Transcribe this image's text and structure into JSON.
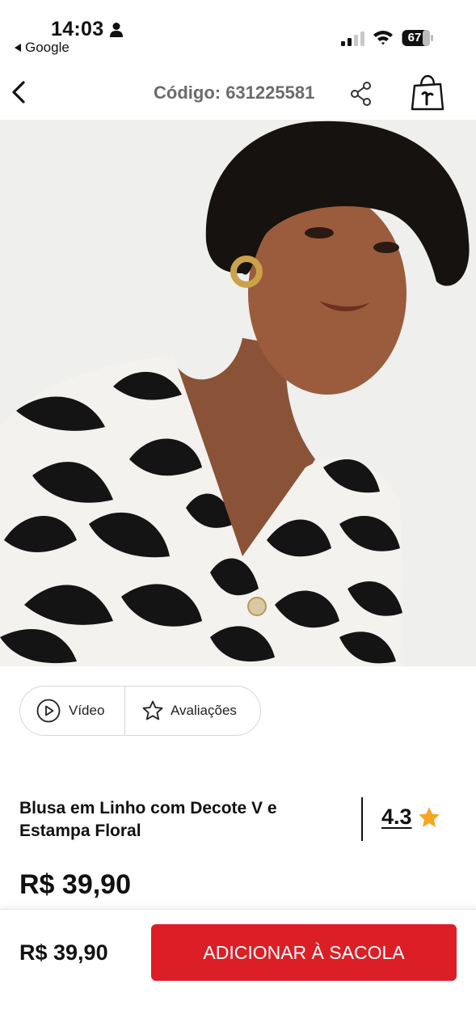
{
  "status_bar": {
    "time": "14:03",
    "back_app": "Google",
    "battery": "67",
    "icons": [
      "person-icon",
      "signal-icon",
      "wifi-icon",
      "battery-icon"
    ]
  },
  "nav": {
    "code_label": "Código: 631225581",
    "icons": [
      "back-chevron-icon",
      "share-icon",
      "shopping-bag-icon"
    ]
  },
  "media_toggle": {
    "video_label": "Vídeo",
    "reviews_label": "Avaliações"
  },
  "product": {
    "title": "Blusa em Linho com Decote V e Estampa Floral",
    "rating": "4.3",
    "price": "R$ 39,90"
  },
  "bottom_bar": {
    "price": "R$ 39,90",
    "add_button_label": "ADICIONAR À SACOLA"
  },
  "colors": {
    "accent": "#dc1f26",
    "star": "#f5a623",
    "nav_text": "#6b6b6b"
  }
}
